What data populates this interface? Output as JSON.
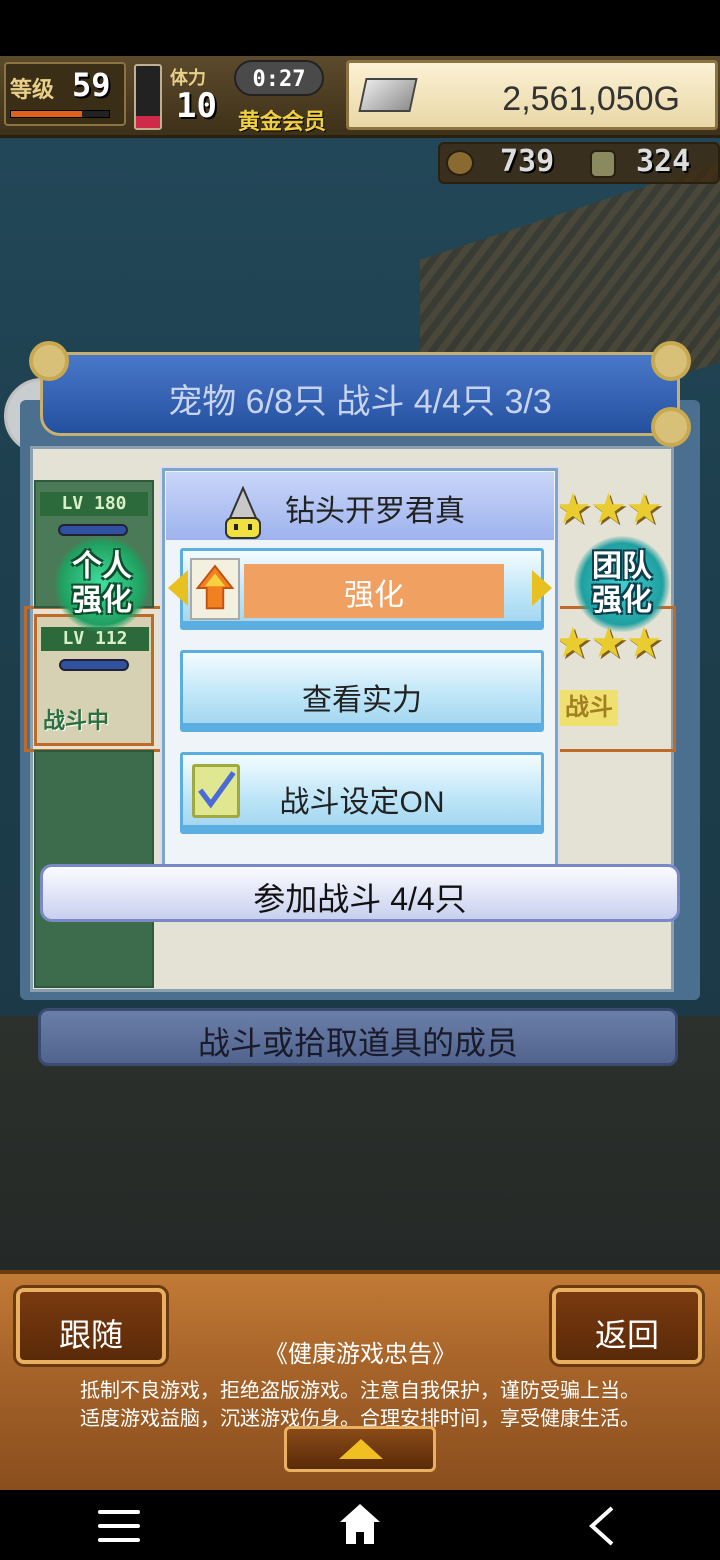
{
  "hud": {
    "level_label": "等级",
    "level_value": "59",
    "level_progress": 0.72,
    "stamina_label": "体力",
    "stamina_value": "10",
    "stamina_level": 0.2,
    "timer": "0:27",
    "membership": "黄金会员",
    "gold": "2,561,050G",
    "resource_1": "739",
    "resource_2": "324"
  },
  "panel": {
    "title": "宠物 6/8只 战斗 4/4只  3/3",
    "pet_1": {
      "level": "LV 180"
    },
    "pet_2": {
      "level": "LV 112",
      "status": "战斗中"
    },
    "personal_boost": "个人\n强化",
    "team_boost": "团队\n强化",
    "stars_row_1": "★★★",
    "stars_row_2": "★★★",
    "battle_tag": "战斗",
    "join_label": "参加战斗 4/4只",
    "description": "战斗或拾取道具的成员"
  },
  "popup": {
    "title": "钻头开罗君真",
    "enhance_label": "强化",
    "view_label": "查看实力",
    "battle_setting_label": "战斗设定ON",
    "battle_setting_checked": true
  },
  "footer": {
    "follow_label": "跟随",
    "return_label": "返回",
    "advisory_title": "《健康游戏忠告》",
    "advisory_line_1": "抵制不良游戏，拒绝盗版游戏。注意自我保护，谨防受骗上当。",
    "advisory_line_2": "适度游戏益脑，沉迷游戏伤身。合理安排时间，享受健康生活。"
  },
  "colors": {
    "accent_gold": "#e8cc30",
    "popup_button": "#bfe6f8",
    "wood": "#a8652a"
  },
  "icons": {
    "float": "bar-chart-icon",
    "nav_menu": "menu-icon",
    "nav_home": "home-icon",
    "nav_back": "back-icon"
  }
}
